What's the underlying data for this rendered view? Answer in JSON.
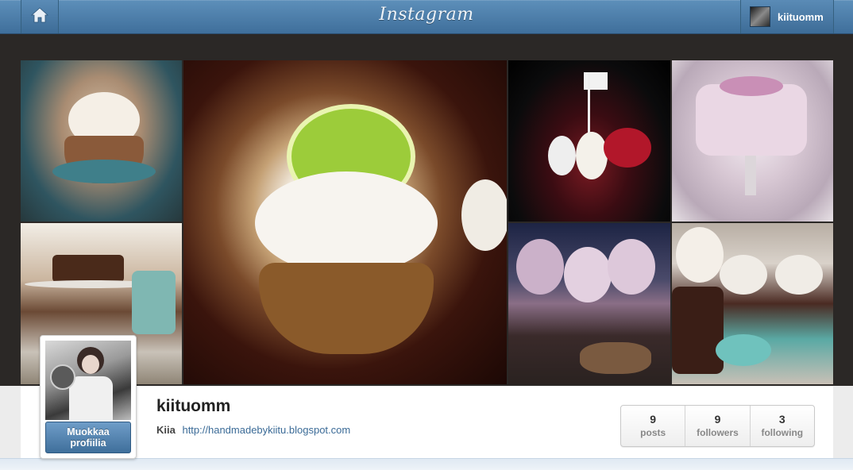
{
  "header": {
    "logo_text": "Instagram",
    "home_icon": "home-icon",
    "username": "kiituomm",
    "brand_color": "#4a7ba7"
  },
  "photos": [
    {
      "name": "photo-pistachio-cupcake"
    },
    {
      "name": "photo-chocolate-cake-stand"
    },
    {
      "name": "photo-lime-cupcake"
    },
    {
      "name": "photo-raspberry-penguins"
    },
    {
      "name": "photo-pink-cheesecake"
    },
    {
      "name": "photo-frosted-cupcakes"
    },
    {
      "name": "photo-chocolate-cupcakes-teal"
    }
  ],
  "profile": {
    "edit_button_label": "Muokkaa profiilia",
    "username": "kiituomm",
    "full_name": "Kiia",
    "website": "http://handmadebykiitu.blogspot.com",
    "stats": [
      {
        "value": "9",
        "label": "posts"
      },
      {
        "value": "9",
        "label": "followers"
      },
      {
        "value": "3",
        "label": "following"
      }
    ]
  }
}
